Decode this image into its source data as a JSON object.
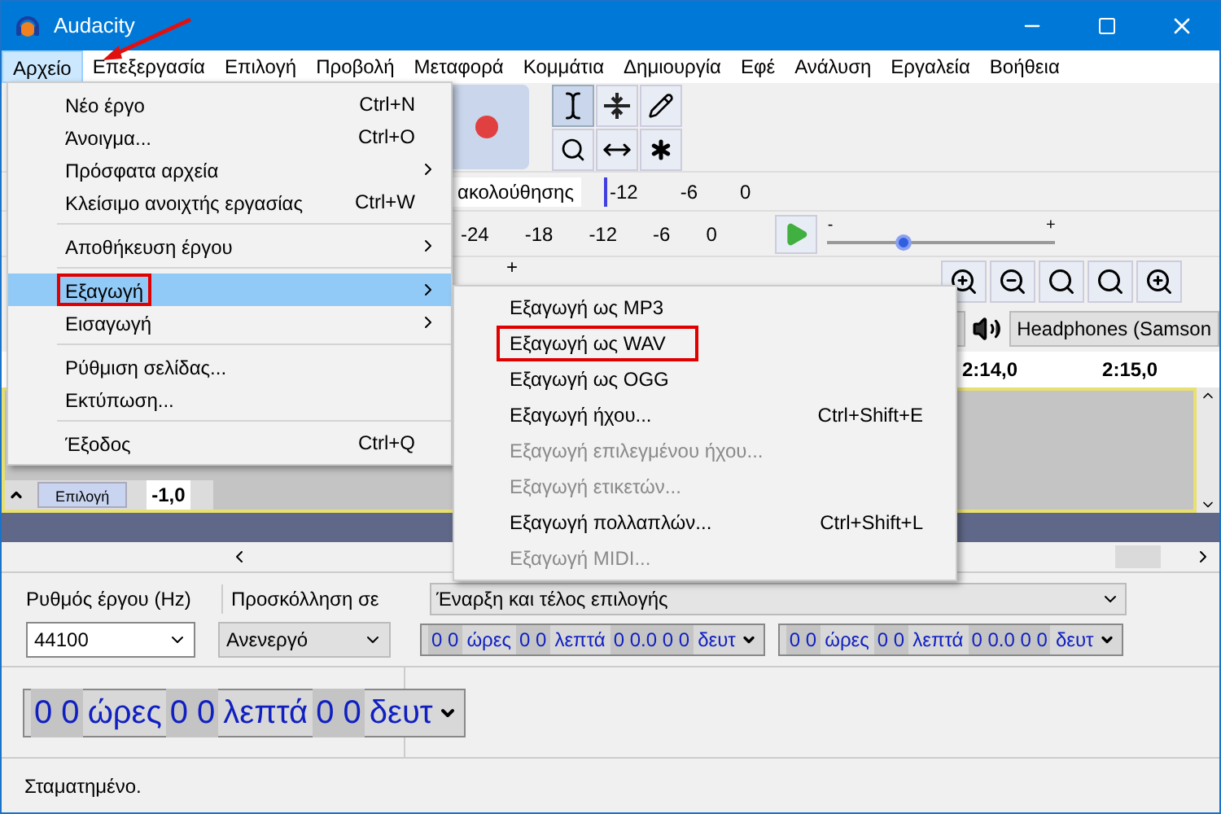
{
  "window": {
    "title": "Audacity"
  },
  "menubar": [
    {
      "label": "Αρχείο",
      "selected": true
    },
    {
      "label": "Επεξεργασία",
      "selected": false
    },
    {
      "label": "Επιλογή",
      "selected": false
    },
    {
      "label": "Προβολή",
      "selected": false
    },
    {
      "label": "Μεταφορά",
      "selected": false
    },
    {
      "label": "Κομμάτια",
      "selected": false
    },
    {
      "label": "Δημιουργία",
      "selected": false
    },
    {
      "label": "Εφέ",
      "selected": false
    },
    {
      "label": "Ανάλυση",
      "selected": false
    },
    {
      "label": "Εργαλεία",
      "selected": false
    },
    {
      "label": "Βοήθεια",
      "selected": false
    }
  ],
  "file_menu": {
    "groups": [
      [
        {
          "label": "Νέο έργο",
          "shortcut": "Ctrl+N",
          "submenu": false,
          "selected": false,
          "marked": false
        },
        {
          "label": "Άνοιγμα...",
          "shortcut": "Ctrl+O",
          "submenu": false,
          "selected": false,
          "marked": false
        },
        {
          "label": "Πρόσφατα αρχεία",
          "submenu": true,
          "selected": false,
          "marked": false
        },
        {
          "label": "Κλείσιμο ανοιχτής εργασίας",
          "shortcut": "Ctrl+W",
          "submenu": false,
          "selected": false,
          "marked": false
        }
      ],
      [
        {
          "label": "Αποθήκευση έργου",
          "submenu": true,
          "selected": false,
          "marked": false
        }
      ],
      [
        {
          "label": "Εξαγωγή",
          "submenu": true,
          "selected": true,
          "marked": true
        },
        {
          "label": "Εισαγωγή",
          "submenu": true,
          "selected": false,
          "marked": false
        }
      ],
      [
        {
          "label": "Ρύθμιση σελίδας...",
          "submenu": false,
          "selected": false,
          "marked": false
        },
        {
          "label": "Εκτύπωση...",
          "submenu": false,
          "selected": false,
          "marked": false
        }
      ],
      [
        {
          "label": "Έξοδος",
          "shortcut": "Ctrl+Q",
          "submenu": false,
          "selected": false,
          "marked": false
        }
      ]
    ]
  },
  "export_submenu": [
    {
      "label": "Εξαγωγή ως MP3",
      "disabled": false,
      "marked": false
    },
    {
      "label": "Εξαγωγή ως WAV",
      "disabled": false,
      "marked": true
    },
    {
      "label": "Εξαγωγή ως OGG",
      "disabled": false,
      "marked": false
    },
    {
      "label": "Εξαγωγή ήχου...",
      "shortcut": "Ctrl+Shift+E",
      "disabled": false,
      "marked": false
    },
    {
      "label": "Εξαγωγή επιλεγμένου ήχου...",
      "disabled": true,
      "marked": false
    },
    {
      "label": "Εξαγωγή ετικετών...",
      "disabled": true,
      "marked": false
    },
    {
      "label": "Εξαγωγή πολλαπλών...",
      "shortcut": "Ctrl+Shift+L",
      "disabled": false,
      "marked": false
    },
    {
      "label": "Εξαγωγή MIDI...",
      "disabled": true,
      "marked": false
    }
  ],
  "meters": {
    "record_label": "ακολούθησης",
    "record_ticks": [
      "-12",
      "-6",
      "0"
    ],
    "play_ticks": [
      "-24",
      "-18",
      "-12",
      "-6",
      "0"
    ]
  },
  "play_speed": {
    "minus": "-",
    "plus": "+",
    "level": 0.33
  },
  "edit_toolbar": {
    "plus": "+"
  },
  "device": {
    "output": "Headphones (Samson"
  },
  "ruler": {
    "labels": [
      "2:14,0",
      "2:15,0"
    ]
  },
  "track": {
    "select_button": "Επιλογή",
    "scale_value": "-1,0"
  },
  "selection_toolbar": {
    "rate_label": "Ρυθμός έργου (Hz)",
    "snap_label": "Προσκόλληση σε",
    "mode": "Έναρξη και τέλος επιλογής",
    "rate": "44100",
    "snap": "Ανενεργό",
    "start_time": [
      "0 0",
      "ώρες",
      "0 0",
      "λεπτά",
      "0 0.0 0 0",
      "δευτ"
    ],
    "end_time": [
      "0 0",
      "ώρες",
      "0 0",
      "λεπτά",
      "0 0.0 0 0",
      "δευτ"
    ]
  },
  "time_toolbar": {
    "time": [
      "0 0",
      "ώρες",
      "0 0",
      "λεπτά",
      "0 0",
      "δευτ"
    ]
  },
  "status_bar": {
    "text": "Σταματημένο."
  }
}
